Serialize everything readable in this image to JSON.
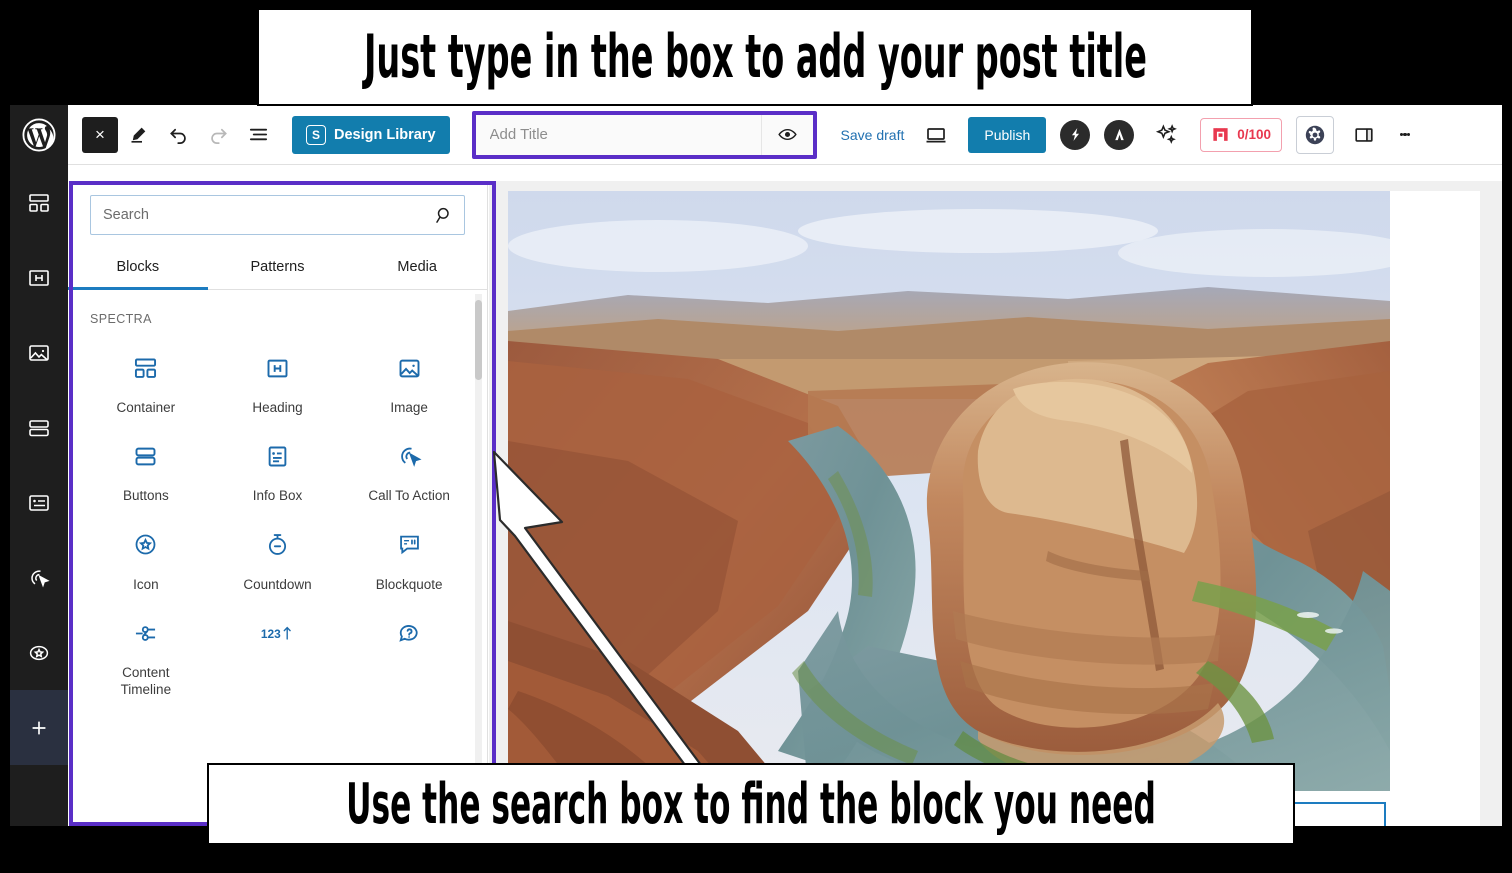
{
  "app": {
    "name": "WordPress Block Editor"
  },
  "rail": {
    "logo": "wordpress-logo",
    "items": [
      {
        "icon": "container-blocks-icon",
        "label": "Container"
      },
      {
        "icon": "heading-icon",
        "label": "Heading"
      },
      {
        "icon": "image-icon",
        "label": "Image"
      },
      {
        "icon": "buttons-icon",
        "label": "Buttons"
      },
      {
        "icon": "info-box-icon",
        "label": "Info Box"
      },
      {
        "icon": "call-to-action-icon",
        "label": "Call To Action"
      },
      {
        "icon": "icon-block-icon",
        "label": "Icon"
      },
      {
        "icon": "plus-icon",
        "label": "Add block"
      }
    ]
  },
  "toolbar": {
    "close_label": "×",
    "edit_icon": "pencil-icon",
    "undo_icon": "undo-icon",
    "redo_icon": "redo-icon",
    "list_view_icon": "list-view-icon",
    "design_library_badge": "S",
    "design_library_label": "Design Library",
    "save_draft_label": "Save draft",
    "preview_icon": "desktop-preview-icon",
    "publish_label": "Publish",
    "spectra_icon": "spectra-bolt-icon",
    "astra_icon": "astra-icon",
    "ai_icon": "ai-sparkle-icon",
    "seo_score": "0/100",
    "seo_icon": "rankmath-icon",
    "settings_icon": "gear-icon",
    "sidebar_toggle_icon": "sidebar-panel-icon",
    "kebab_icon": "more-options-icon"
  },
  "title_field": {
    "placeholder": "Add Title",
    "value": "",
    "eye_icon": "eye-icon"
  },
  "inserter": {
    "search": {
      "placeholder": "Search",
      "value": "",
      "icon": "search-icon"
    },
    "tabs": [
      {
        "label": "Blocks",
        "active": true
      },
      {
        "label": "Patterns",
        "active": false
      },
      {
        "label": "Media",
        "active": false
      }
    ],
    "category": "SPECTRA",
    "blocks": [
      {
        "label": "Container",
        "icon": "container-icon"
      },
      {
        "label": "Heading",
        "icon": "heading-h-icon"
      },
      {
        "label": "Image",
        "icon": "image-icon"
      },
      {
        "label": "Buttons",
        "icon": "buttons-icon"
      },
      {
        "label": "Info Box",
        "icon": "info-box-icon"
      },
      {
        "label": "Call To Action",
        "icon": "call-to-action-icon"
      },
      {
        "label": "Icon",
        "icon": "star-badge-icon"
      },
      {
        "label": "Countdown",
        "icon": "stopwatch-icon"
      },
      {
        "label": "Blockquote",
        "icon": "quote-bubble-icon"
      },
      {
        "label": "Content Timeline",
        "icon": "timeline-icon"
      },
      {
        "label": "",
        "icon": "counter-123-icon"
      },
      {
        "label": "",
        "icon": "faq-question-icon"
      }
    ]
  },
  "canvas": {
    "image_alt": "Horseshoe Bend canyon with river",
    "empty_paragraph_placeholder": ""
  },
  "annotations": [
    {
      "id": "callout-title",
      "text": "Just type in the box to add your post title"
    },
    {
      "id": "callout-search",
      "text": "Use the search box to find the block you need"
    }
  ],
  "colors": {
    "highlight_purple": "#5a2ec7",
    "accent_blue": "#127dad",
    "link_blue": "#2271b1",
    "block_icon_blue": "#1c6aab",
    "seo_red": "#e8384f",
    "rail_dark": "#1e1e1e"
  }
}
